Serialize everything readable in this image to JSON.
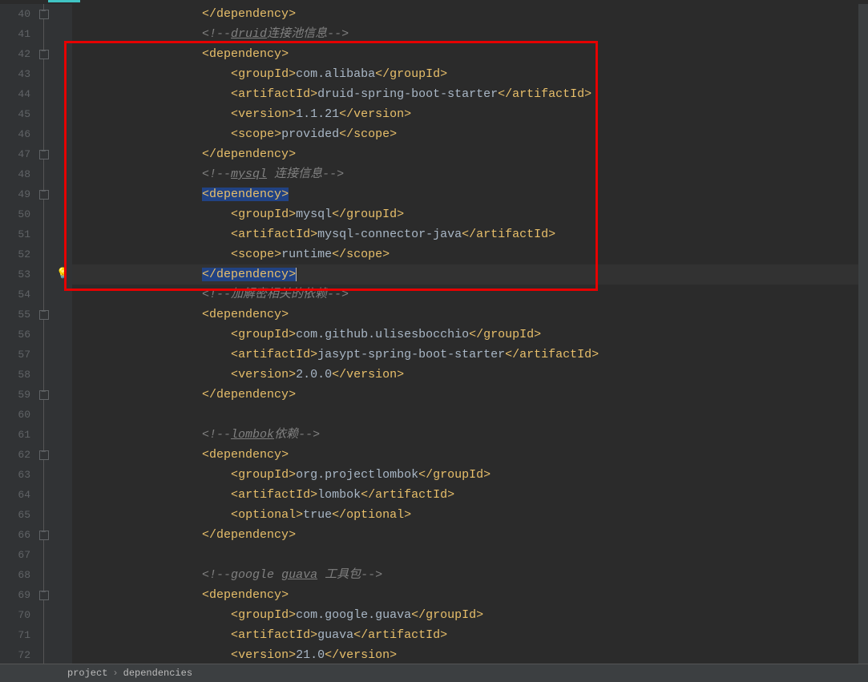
{
  "breadcrumb": {
    "a": "project",
    "b": "dependencies"
  },
  "icons": {
    "bulb": "💡"
  },
  "highlight_box": {
    "top_line": 42,
    "bottom_line": 53
  },
  "lines": [
    {
      "n": 40,
      "ind": 4,
      "seg": [
        {
          "c": "b",
          "t": "</"
        },
        {
          "c": "t",
          "t": "dependency"
        },
        {
          "c": "b",
          "t": ">"
        }
      ]
    },
    {
      "n": 41,
      "ind": 4,
      "seg": [
        {
          "c": "cmt",
          "t": "<!--"
        },
        {
          "c": "cmtu",
          "t": "druid"
        },
        {
          "c": "cmt",
          "t": "连接池信息-->"
        }
      ]
    },
    {
      "n": 42,
      "ind": 4,
      "seg": [
        {
          "c": "b",
          "t": "<"
        },
        {
          "c": "t",
          "t": "dependency"
        },
        {
          "c": "b",
          "t": ">"
        }
      ]
    },
    {
      "n": 43,
      "ind": 5,
      "seg": [
        {
          "c": "b",
          "t": "<"
        },
        {
          "c": "t",
          "t": "groupId"
        },
        {
          "c": "b",
          "t": ">"
        },
        {
          "c": "txt",
          "t": "com.alibaba"
        },
        {
          "c": "b",
          "t": "</"
        },
        {
          "c": "t",
          "t": "groupId"
        },
        {
          "c": "b",
          "t": ">"
        }
      ]
    },
    {
      "n": 44,
      "ind": 5,
      "seg": [
        {
          "c": "b",
          "t": "<"
        },
        {
          "c": "t",
          "t": "artifactId"
        },
        {
          "c": "b",
          "t": ">"
        },
        {
          "c": "txt",
          "t": "druid-spring-boot-starter"
        },
        {
          "c": "b",
          "t": "</"
        },
        {
          "c": "t",
          "t": "artifactId"
        },
        {
          "c": "b",
          "t": ">"
        }
      ]
    },
    {
      "n": 45,
      "ind": 5,
      "seg": [
        {
          "c": "b",
          "t": "<"
        },
        {
          "c": "t",
          "t": "version"
        },
        {
          "c": "b",
          "t": ">"
        },
        {
          "c": "txt",
          "t": "1.1.21"
        },
        {
          "c": "b",
          "t": "</"
        },
        {
          "c": "t",
          "t": "version"
        },
        {
          "c": "b",
          "t": ">"
        }
      ]
    },
    {
      "n": 46,
      "ind": 5,
      "seg": [
        {
          "c": "b",
          "t": "<"
        },
        {
          "c": "t",
          "t": "scope"
        },
        {
          "c": "b",
          "t": ">"
        },
        {
          "c": "txt",
          "t": "provided"
        },
        {
          "c": "b",
          "t": "</"
        },
        {
          "c": "t",
          "t": "scope"
        },
        {
          "c": "b",
          "t": ">"
        }
      ]
    },
    {
      "n": 47,
      "ind": 4,
      "seg": [
        {
          "c": "b",
          "t": "</"
        },
        {
          "c": "t",
          "t": "dependency"
        },
        {
          "c": "b",
          "t": ">"
        }
      ]
    },
    {
      "n": 48,
      "ind": 4,
      "seg": [
        {
          "c": "cmt",
          "t": "<!--"
        },
        {
          "c": "cmtu",
          "t": "mysql"
        },
        {
          "c": "cmt",
          "t": " 连接信息-->"
        }
      ]
    },
    {
      "n": 49,
      "ind": 4,
      "seg": [
        {
          "c": "b",
          "t": "<",
          "sel": true
        },
        {
          "c": "t",
          "t": "dependency",
          "sel": true
        },
        {
          "c": "b",
          "t": ">",
          "sel": true
        }
      ]
    },
    {
      "n": 50,
      "ind": 5,
      "seg": [
        {
          "c": "b",
          "t": "<"
        },
        {
          "c": "t",
          "t": "groupId"
        },
        {
          "c": "b",
          "t": ">"
        },
        {
          "c": "txt",
          "t": "mysql"
        },
        {
          "c": "b",
          "t": "</"
        },
        {
          "c": "t",
          "t": "groupId"
        },
        {
          "c": "b",
          "t": ">"
        }
      ]
    },
    {
      "n": 51,
      "ind": 5,
      "seg": [
        {
          "c": "b",
          "t": "<"
        },
        {
          "c": "t",
          "t": "artifactId"
        },
        {
          "c": "b",
          "t": ">"
        },
        {
          "c": "txt",
          "t": "mysql-connector-java"
        },
        {
          "c": "b",
          "t": "</"
        },
        {
          "c": "t",
          "t": "artifactId"
        },
        {
          "c": "b",
          "t": ">"
        }
      ]
    },
    {
      "n": 52,
      "ind": 5,
      "seg": [
        {
          "c": "b",
          "t": "<"
        },
        {
          "c": "t",
          "t": "scope"
        },
        {
          "c": "b",
          "t": ">"
        },
        {
          "c": "txt",
          "t": "runtime"
        },
        {
          "c": "b",
          "t": "</"
        },
        {
          "c": "t",
          "t": "scope"
        },
        {
          "c": "b",
          "t": ">"
        }
      ]
    },
    {
      "n": 53,
      "ind": 4,
      "current": true,
      "bulb": true,
      "caret": true,
      "seg": [
        {
          "c": "b",
          "t": "</",
          "sel": true
        },
        {
          "c": "t",
          "t": "dependency",
          "sel": true
        },
        {
          "c": "b",
          "t": ">",
          "sel": true
        }
      ]
    },
    {
      "n": 54,
      "ind": 4,
      "seg": [
        {
          "c": "cmt",
          "t": "<!--加解密相关的依赖-->"
        }
      ]
    },
    {
      "n": 55,
      "ind": 4,
      "seg": [
        {
          "c": "b",
          "t": "<"
        },
        {
          "c": "t",
          "t": "dependency"
        },
        {
          "c": "b",
          "t": ">"
        }
      ]
    },
    {
      "n": 56,
      "ind": 5,
      "seg": [
        {
          "c": "b",
          "t": "<"
        },
        {
          "c": "t",
          "t": "groupId"
        },
        {
          "c": "b",
          "t": ">"
        },
        {
          "c": "txt",
          "t": "com.github.ulisesbocchio"
        },
        {
          "c": "b",
          "t": "</"
        },
        {
          "c": "t",
          "t": "groupId"
        },
        {
          "c": "b",
          "t": ">"
        }
      ]
    },
    {
      "n": 57,
      "ind": 5,
      "seg": [
        {
          "c": "b",
          "t": "<"
        },
        {
          "c": "t",
          "t": "artifactId"
        },
        {
          "c": "b",
          "t": ">"
        },
        {
          "c": "txt",
          "t": "jasypt-spring-boot-starter"
        },
        {
          "c": "b",
          "t": "</"
        },
        {
          "c": "t",
          "t": "artifactId"
        },
        {
          "c": "b",
          "t": ">"
        }
      ]
    },
    {
      "n": 58,
      "ind": 5,
      "seg": [
        {
          "c": "b",
          "t": "<"
        },
        {
          "c": "t",
          "t": "version"
        },
        {
          "c": "b",
          "t": ">"
        },
        {
          "c": "txt",
          "t": "2.0.0"
        },
        {
          "c": "b",
          "t": "</"
        },
        {
          "c": "t",
          "t": "version"
        },
        {
          "c": "b",
          "t": ">"
        }
      ]
    },
    {
      "n": 59,
      "ind": 4,
      "seg": [
        {
          "c": "b",
          "t": "</"
        },
        {
          "c": "t",
          "t": "dependency"
        },
        {
          "c": "b",
          "t": ">"
        }
      ]
    },
    {
      "n": 60,
      "ind": 0,
      "seg": []
    },
    {
      "n": 61,
      "ind": 4,
      "seg": [
        {
          "c": "cmt",
          "t": "<!--"
        },
        {
          "c": "cmtu",
          "t": "lombok"
        },
        {
          "c": "cmt",
          "t": "依赖-->"
        }
      ]
    },
    {
      "n": 62,
      "ind": 4,
      "seg": [
        {
          "c": "b",
          "t": "<"
        },
        {
          "c": "t",
          "t": "dependency"
        },
        {
          "c": "b",
          "t": ">"
        }
      ]
    },
    {
      "n": 63,
      "ind": 5,
      "seg": [
        {
          "c": "b",
          "t": "<"
        },
        {
          "c": "t",
          "t": "groupId"
        },
        {
          "c": "b",
          "t": ">"
        },
        {
          "c": "txt",
          "t": "org.projectlombok"
        },
        {
          "c": "b",
          "t": "</"
        },
        {
          "c": "t",
          "t": "groupId"
        },
        {
          "c": "b",
          "t": ">"
        }
      ]
    },
    {
      "n": 64,
      "ind": 5,
      "seg": [
        {
          "c": "b",
          "t": "<"
        },
        {
          "c": "t",
          "t": "artifactId"
        },
        {
          "c": "b",
          "t": ">"
        },
        {
          "c": "txt",
          "t": "lombok"
        },
        {
          "c": "b",
          "t": "</"
        },
        {
          "c": "t",
          "t": "artifactId"
        },
        {
          "c": "b",
          "t": ">"
        }
      ]
    },
    {
      "n": 65,
      "ind": 5,
      "seg": [
        {
          "c": "b",
          "t": "<"
        },
        {
          "c": "t",
          "t": "optional"
        },
        {
          "c": "b",
          "t": ">"
        },
        {
          "c": "txt",
          "t": "true"
        },
        {
          "c": "b",
          "t": "</"
        },
        {
          "c": "t",
          "t": "optional"
        },
        {
          "c": "b",
          "t": ">"
        }
      ]
    },
    {
      "n": 66,
      "ind": 4,
      "seg": [
        {
          "c": "b",
          "t": "</"
        },
        {
          "c": "t",
          "t": "dependency"
        },
        {
          "c": "b",
          "t": ">"
        }
      ]
    },
    {
      "n": 67,
      "ind": 0,
      "seg": []
    },
    {
      "n": 68,
      "ind": 4,
      "seg": [
        {
          "c": "cmt",
          "t": "<!--google "
        },
        {
          "c": "cmtu",
          "t": "guava"
        },
        {
          "c": "cmt",
          "t": " 工具包-->"
        }
      ]
    },
    {
      "n": 69,
      "ind": 4,
      "seg": [
        {
          "c": "b",
          "t": "<"
        },
        {
          "c": "t",
          "t": "dependency"
        },
        {
          "c": "b",
          "t": ">"
        }
      ]
    },
    {
      "n": 70,
      "ind": 5,
      "seg": [
        {
          "c": "b",
          "t": "<"
        },
        {
          "c": "t",
          "t": "groupId"
        },
        {
          "c": "b",
          "t": ">"
        },
        {
          "c": "txt",
          "t": "com.google.guava"
        },
        {
          "c": "b",
          "t": "</"
        },
        {
          "c": "t",
          "t": "groupId"
        },
        {
          "c": "b",
          "t": ">"
        }
      ]
    },
    {
      "n": 71,
      "ind": 5,
      "seg": [
        {
          "c": "b",
          "t": "<"
        },
        {
          "c": "t",
          "t": "artifactId"
        },
        {
          "c": "b",
          "t": ">"
        },
        {
          "c": "txt",
          "t": "guava"
        },
        {
          "c": "b",
          "t": "</"
        },
        {
          "c": "t",
          "t": "artifactId"
        },
        {
          "c": "b",
          "t": ">"
        }
      ]
    },
    {
      "n": 72,
      "ind": 5,
      "seg": [
        {
          "c": "b",
          "t": "<"
        },
        {
          "c": "t",
          "t": "version"
        },
        {
          "c": "b",
          "t": ">"
        },
        {
          "c": "txt",
          "t": "21.0"
        },
        {
          "c": "b",
          "t": "</"
        },
        {
          "c": "t",
          "t": "version"
        },
        {
          "c": "b",
          "t": ">"
        }
      ]
    }
  ],
  "fold_markers": [
    40,
    42,
    47,
    49,
    55,
    59,
    62,
    66,
    69
  ],
  "fold_bar": {
    "from": 40,
    "to": 72
  }
}
